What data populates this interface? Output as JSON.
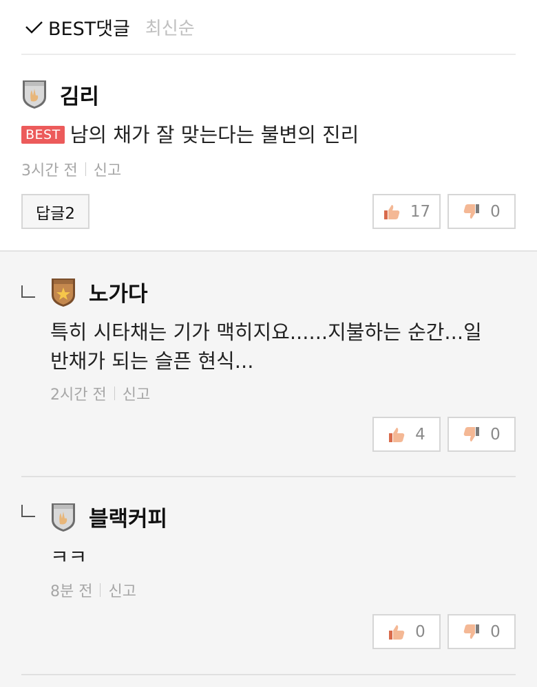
{
  "sort": {
    "best_label": "BEST댓글",
    "recent_label": "최신순"
  },
  "comments": [
    {
      "nickname": "김리",
      "best_tag": "BEST",
      "text": "남의 채가 잘 맞는다는 불변의 진리",
      "time": "3시간 전",
      "report": "신고",
      "reply_label": "답글2",
      "likes": "17",
      "dislikes": "0"
    }
  ],
  "replies": [
    {
      "nickname": "노가다",
      "text_line1": "특히 시타채는 기가 맥히지요......지불하는 순간...일",
      "text_line2": "반채가 되는 슬픈 현식...",
      "time": "2시간 전",
      "report": "신고",
      "likes": "4",
      "dislikes": "0"
    },
    {
      "nickname": "블랙커피",
      "text": "ㅋㅋ",
      "time": "8분 전",
      "report": "신고",
      "likes": "0",
      "dislikes": "0"
    }
  ],
  "icons": {
    "sort_check": "checkmark-icon",
    "like": "thumbs-up-icon",
    "dislike": "thumbs-down-icon",
    "badge_rookie": "rookie-badge-icon",
    "badge_senior": "senior-badge-icon"
  }
}
